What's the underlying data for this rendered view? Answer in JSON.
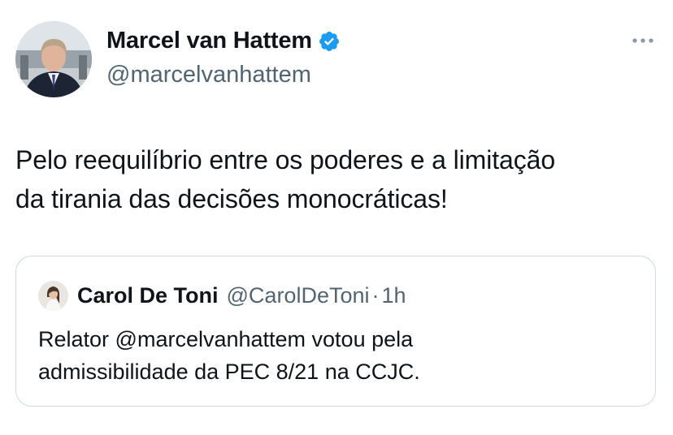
{
  "tweet": {
    "author": {
      "name": "Marcel van Hattem",
      "handle": "@marcelvanhattem",
      "avatar_icon": "profile-photo-man-suit",
      "verified_icon": "verified-badge-icon",
      "verified_color": "#1d9bf0"
    },
    "more_icon": "more-horizontal-icon",
    "text": "Pelo reequilíbrio entre os poderes e a limitação\nda tirania das decisões monocráticas!"
  },
  "quoted": {
    "author": {
      "name": "Carol De Toni",
      "handle": "@CarolDeToni",
      "avatar_icon": "profile-photo-woman"
    },
    "separator": "·",
    "time": "1h",
    "text": "Relator @marcelvanhattem votou pela\nadmissibilidade da PEC 8/21 na CCJC."
  },
  "colors": {
    "text_primary": "#0f1419",
    "text_secondary": "#536471",
    "border": "#cfd9de",
    "accent": "#1d9bf0"
  }
}
